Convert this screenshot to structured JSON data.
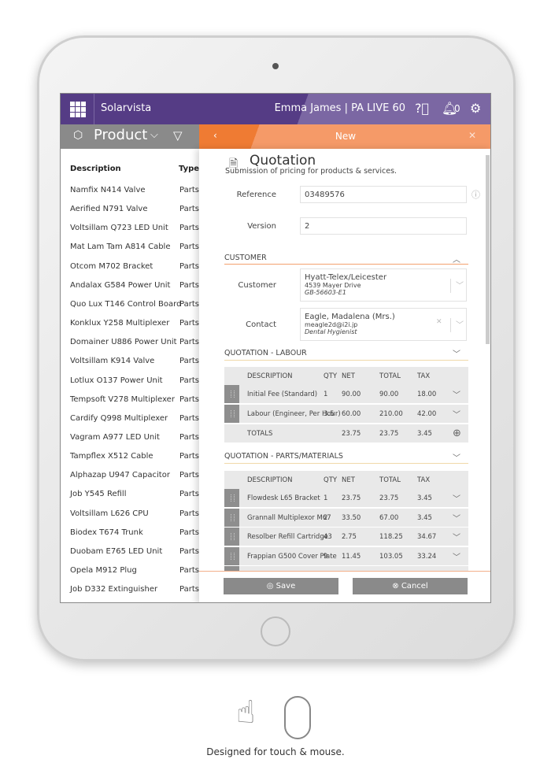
{
  "header": {
    "brand": "Solarvista",
    "user": "Emma James | PA LIVE 60",
    "notifications": "0",
    "icons": [
      "apps-grid-icon",
      "help-icon",
      "bell-icon",
      "gear-icon"
    ]
  },
  "sidebar": {
    "title": "Product",
    "col_description": "Description",
    "col_type": "Type",
    "items": [
      {
        "description": "Namfix N414 Valve",
        "type": "Parts/"
      },
      {
        "description": "Aerified N791 Valve",
        "type": "Parts/"
      },
      {
        "description": "Voltsillam Q723 LED Unit",
        "type": "Parts/"
      },
      {
        "description": "Mat Lam Tam A814 Cable",
        "type": "Parts/"
      },
      {
        "description": "Otcom M702 Bracket",
        "type": "Parts/"
      },
      {
        "description": "Andalax G584 Power Unit",
        "type": "Parts/"
      },
      {
        "description": "Quo Lux T146 Control Board",
        "type": "Parts/"
      },
      {
        "description": "Konklux Y258 Multiplexer",
        "type": "Parts/"
      },
      {
        "description": "Domainer U886 Power Unit",
        "type": "Parts/"
      },
      {
        "description": "Voltsillam K914 Valve",
        "type": "Parts/"
      },
      {
        "description": "Lotlux O137 Power Unit",
        "type": "Parts/"
      },
      {
        "description": "Tempsoft V278 Multiplexer",
        "type": "Parts/"
      },
      {
        "description": "Cardify Q998 Multiplexer",
        "type": "Parts/"
      },
      {
        "description": "Vagram A977 LED Unit",
        "type": "Parts/"
      },
      {
        "description": "Tampflex X512 Cable",
        "type": "Parts/"
      },
      {
        "description": "Alphazap U947 Capacitor",
        "type": "Parts/"
      },
      {
        "description": "Job Y545 Refill",
        "type": "Parts/"
      },
      {
        "description": "Voltsillam L626 CPU",
        "type": "Parts/"
      },
      {
        "description": "Biodex T674 Trunk",
        "type": "Parts/"
      },
      {
        "description": "Duobam E765 LED Unit",
        "type": "Parts/"
      },
      {
        "description": "Opela M912 Plug",
        "type": "Parts/"
      },
      {
        "description": "Job D332 Extinguisher",
        "type": "Parts/"
      }
    ]
  },
  "panel": {
    "nav_title": "New",
    "title": "Quotation",
    "subtitle": "Submission of pricing for products & services.",
    "reference_label": "Reference",
    "reference": "03489576",
    "version_label": "Version",
    "version": "2",
    "customer_section": "CUSTOMER",
    "customer_label": "Customer",
    "customer_name": "Hyatt-Telex/Leicester",
    "customer_address": "4539 Mayer Drive",
    "customer_code": "GB-56603-E1",
    "contact_label": "Contact",
    "contact_name": "Eagle, Madalena (Mrs.)",
    "contact_email": "meagle2d@i2i.jp",
    "contact_role": "Dental Hygienist",
    "columns": [
      "DESCRIPTION",
      "QTY",
      "NET",
      "TOTAL",
      "TAX"
    ],
    "labour_section": "QUOTATION - LABOUR",
    "labour": [
      [
        "Initial Fee (Standard)",
        "1",
        "90.00",
        "90.00",
        "18.00"
      ],
      [
        "Labour (Engineer, Per Hour)",
        "3.5",
        "60.00",
        "210.00",
        "42.00"
      ]
    ],
    "totals": [
      "TOTALS",
      "",
      "23.75",
      "23.75",
      "3.45"
    ],
    "parts_section": "QUOTATION - PARTS/MATERIALS",
    "parts": [
      [
        "Flowdesk L65 Bracket",
        "1",
        "23.75",
        "23.75",
        "3.45"
      ],
      [
        "Grannall Multiplexor M67",
        "2",
        "33.50",
        "67.00",
        "3.45"
      ],
      [
        "Resolber Refill Cartridge",
        "43",
        "2.75",
        "118.25",
        "34.67"
      ],
      [
        "Frappian G500 Cover Plate",
        "9",
        "11.45",
        "103.05",
        "33.24"
      ]
    ],
    "save": "Save",
    "cancel": "Cancel"
  },
  "caption": "Designed for touch & mouse.",
  "colors": {
    "purple": "#553c85",
    "orange": "#ef7b33",
    "grey": "#8a8a8a"
  }
}
